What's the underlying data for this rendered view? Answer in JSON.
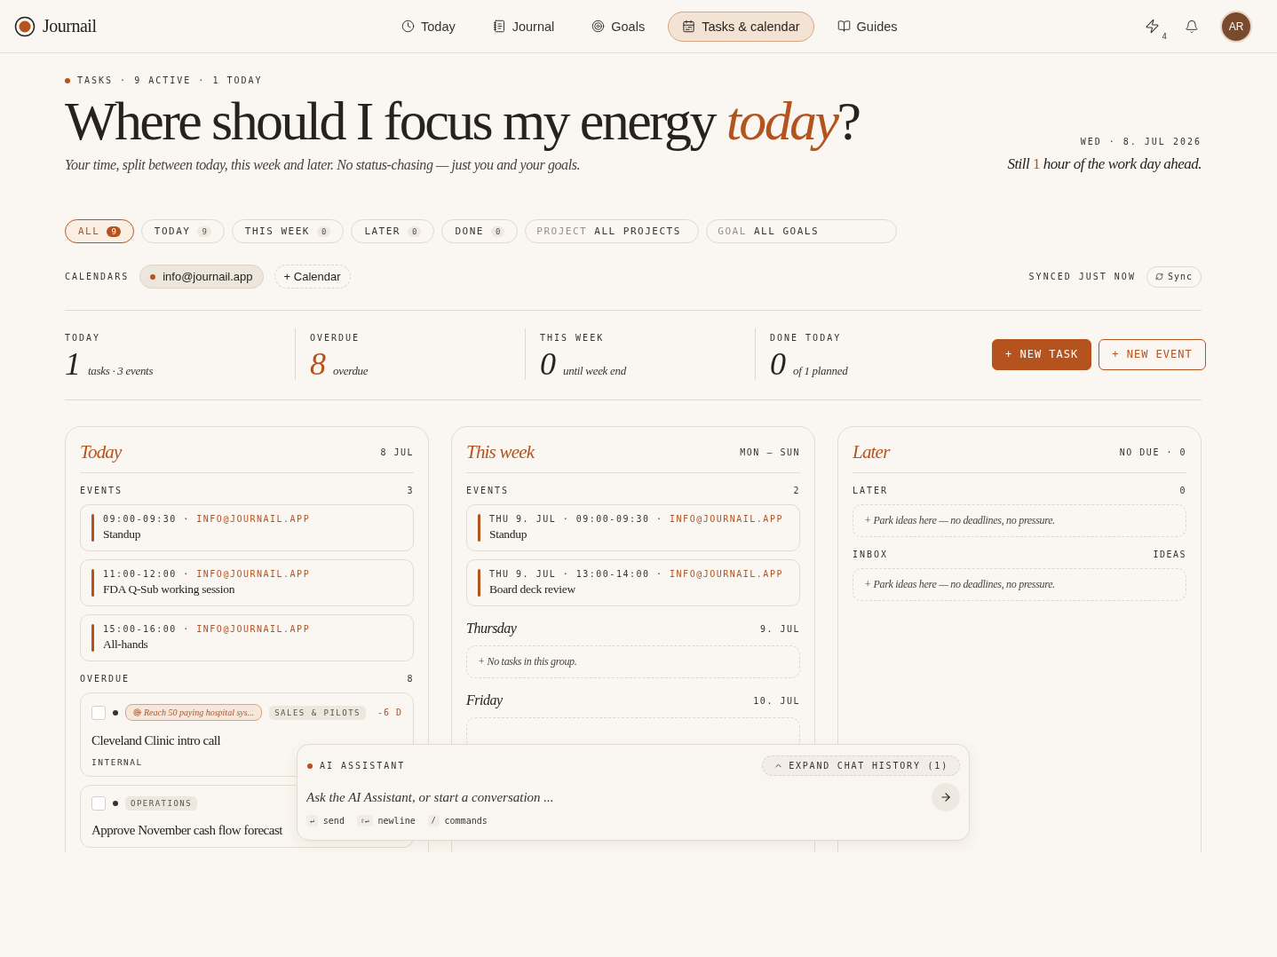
{
  "brand": {
    "name": "Journail"
  },
  "nav": [
    {
      "label": "Today",
      "selected": false
    },
    {
      "label": "Journal",
      "selected": false
    },
    {
      "label": "Goals",
      "selected": false
    },
    {
      "label": "Tasks & calendar",
      "selected": true
    },
    {
      "label": "Guides",
      "selected": false
    }
  ],
  "header_actions": {
    "activity_count": "4",
    "avatar": "AR"
  },
  "eyebrow": "TASKS · 9 ACTIVE · 1 TODAY",
  "headline": "Where should I focus my energy *today*?",
  "subtitle": "Your time, split between today, this week and later. No status-chasing — just you and your goals.",
  "date": "WED · 8. JUL 2026",
  "remaining": "Still *1* hour of the work day ahead.",
  "filters": [
    {
      "label": "ALL",
      "count": "9",
      "selected": true
    },
    {
      "label": "TODAY",
      "count": "9",
      "selected": false
    },
    {
      "label": "THIS WEEK",
      "count": "0",
      "selected": false
    },
    {
      "label": "LATER",
      "count": "0",
      "selected": false
    },
    {
      "label": "DONE",
      "count": "0",
      "selected": false
    }
  ],
  "selects": [
    {
      "label": "PROJECT",
      "value": "ALL PROJECTS"
    },
    {
      "label": "GOAL",
      "value": "ALL GOALS"
    }
  ],
  "calendars": {
    "label": "CALENDARS",
    "items": [
      {
        "label": "info@journail.app",
        "color": "#b5531f"
      }
    ],
    "add": "+ Calendar",
    "status": "SYNCED JUST NOW",
    "sync": "Sync"
  },
  "stats": [
    {
      "label": "TODAY",
      "value": "1",
      "caption": "tasks · 3 events",
      "kind": "plain"
    },
    {
      "label": "OVERDUE",
      "value": "8",
      "caption": "overdue",
      "kind": "alert"
    },
    {
      "label": "THIS WEEK",
      "value": "0",
      "caption": "until week end",
      "kind": "plain"
    },
    {
      "label": "DONE TODAY",
      "value": "0",
      "caption": "of 1 planned",
      "kind": "plain"
    }
  ],
  "actions": [
    {
      "label": "+ NEW TASK",
      "kind": "primary"
    },
    {
      "label": "+ NEW EVENT",
      "kind": "outline"
    }
  ],
  "columns": [
    {
      "title": "Today",
      "meta": "8 JUL",
      "sections": [
        {
          "kind": "events",
          "label": "EVENTS",
          "count": "3",
          "items": [
            {
              "when": "09:00-09:30 ·",
              "calendar": "INFO@JOURNAIL.APP",
              "title": "Standup"
            },
            {
              "when": "11:00-12:00 ·",
              "calendar": "INFO@JOURNAIL.APP",
              "title": "FDA Q-Sub working session"
            },
            {
              "when": "15:00-16:00 ·",
              "calendar": "INFO@JOURNAIL.APP",
              "title": "All-hands"
            }
          ]
        },
        {
          "kind": "tasks",
          "label": "OVERDUE",
          "count": "8",
          "items": [
            {
              "checked": false,
              "goal": "Reach 50 paying hospital sys...",
              "tag": "SALES & PILOTS",
              "due": "-6 D",
              "title": "Cleveland Clinic intro call",
              "note": "INTERNAL"
            },
            {
              "checked": false,
              "tag": "OPERATIONS",
              "title": "Approve November cash flow forecast"
            }
          ]
        }
      ]
    },
    {
      "title": "This week",
      "meta": "MON – SUN",
      "sections": [
        {
          "kind": "events",
          "label": "EVENTS",
          "count": "2",
          "items": [
            {
              "when": "THU 9. JUL · 09:00-09:30 ·",
              "calendar": "INFO@JOURNAIL.APP",
              "title": "Standup"
            },
            {
              "when": "THU 9. JUL · 13:00-14:00 ·",
              "calendar": "INFO@JOURNAIL.APP",
              "title": "Board deck review"
            }
          ]
        },
        {
          "kind": "day",
          "label": "Thursday",
          "count": "9. JUL",
          "empty_text": "+ No tasks in this group."
        },
        {
          "kind": "day",
          "label": "Friday",
          "count": "10. JUL"
        }
      ]
    },
    {
      "title": "Later",
      "meta": "NO DUE · 0",
      "sections": [
        {
          "kind": "group",
          "label": "LATER",
          "count": "0",
          "empty_text": "+ Park ideas here — no deadlines, no pressure."
        },
        {
          "kind": "group",
          "label": "INBOX",
          "count": "IDEAS",
          "empty_text": "+ Park ideas here — no deadlines, no pressure."
        }
      ]
    }
  ],
  "assistant": {
    "label": "AI ASSISTANT",
    "history_button": "EXPAND CHAT HISTORY (1)",
    "placeholder": "Ask the AI Assistant, or start a conversation ...",
    "hints": [
      {
        "key": "↵",
        "label": "send"
      },
      {
        "key": "⇧↵",
        "label": "newline"
      },
      {
        "key": "/",
        "label": "commands"
      }
    ]
  }
}
